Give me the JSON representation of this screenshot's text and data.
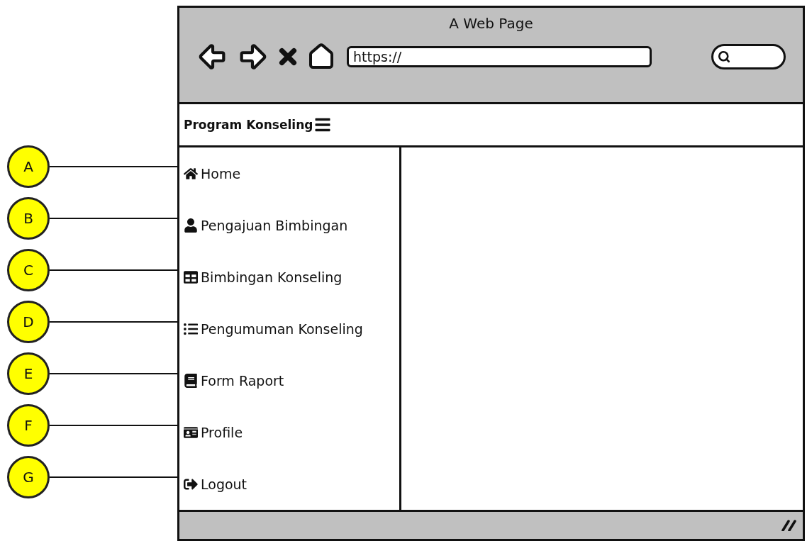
{
  "window": {
    "title": "A Web Page"
  },
  "address_bar": {
    "value": "https://"
  },
  "navbar": {
    "brand": "Program Konseling"
  },
  "sidebar": {
    "items": [
      {
        "label": "Home",
        "callout": "A"
      },
      {
        "label": "Pengajuan Bimbingan",
        "callout": "B"
      },
      {
        "label": "Bimbingan Konseling",
        "callout": "C"
      },
      {
        "label": "Pengumuman Konseling",
        "callout": "D"
      },
      {
        "label": "Form Raport",
        "callout": "E"
      },
      {
        "label": "Profile",
        "callout": "F"
      },
      {
        "label": "Logout",
        "callout": "G"
      }
    ]
  }
}
